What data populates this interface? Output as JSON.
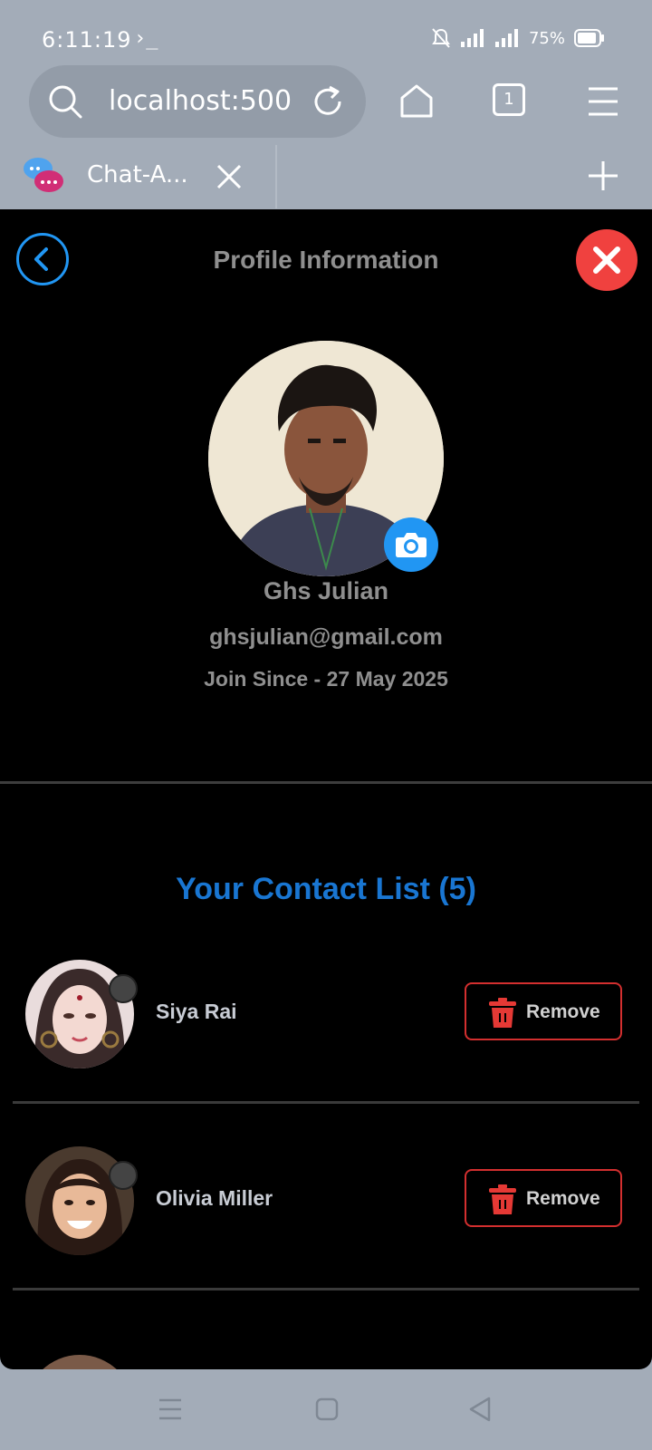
{
  "status_bar": {
    "time": "6:11:19",
    "terminal_glyph": "›_",
    "battery_percent": "75%"
  },
  "browser": {
    "url": "localhost:500",
    "tabs_count": "1",
    "tab_title": "Chat-A..."
  },
  "header": {
    "title": "Profile Information"
  },
  "profile": {
    "name": "Ghs Julian",
    "email": "ghsjulian@gmail.com",
    "join": "Join Since - 27 May 2025"
  },
  "contacts": {
    "title": "Your Contact List (5)",
    "remove_label": "Remove",
    "items": [
      {
        "name": "Siya Rai"
      },
      {
        "name": "Olivia Miller"
      }
    ]
  },
  "colors": {
    "accent_blue": "#2196f3",
    "title_blue": "#1976d2",
    "danger_red": "#f0413f",
    "remove_border": "#d32f2f",
    "app_bg": "#000000",
    "chrome_bg": "#a3acb8"
  }
}
